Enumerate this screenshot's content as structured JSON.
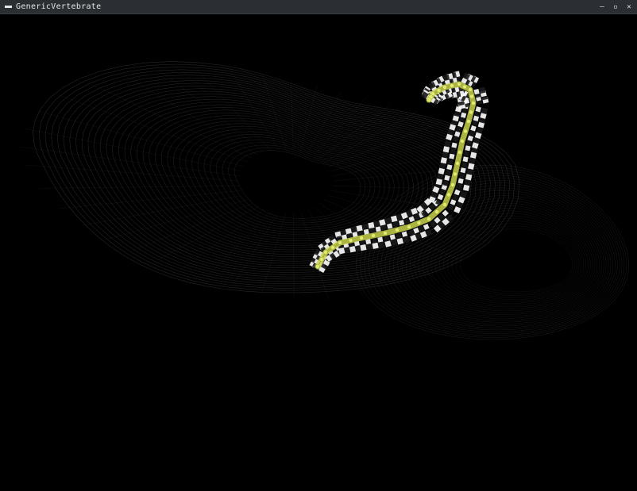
{
  "window": {
    "title": "GenericVertebrate",
    "minimize_glyph": "‒",
    "maximize_glyph": "▫",
    "close_glyph": "✕"
  },
  "viewport": {
    "background": "#000000",
    "wireframe_color": "#8a8a8a",
    "spine_color": "#c8d24a",
    "checker_light": "#ffffff",
    "checker_dark": "#1a1a1a"
  }
}
